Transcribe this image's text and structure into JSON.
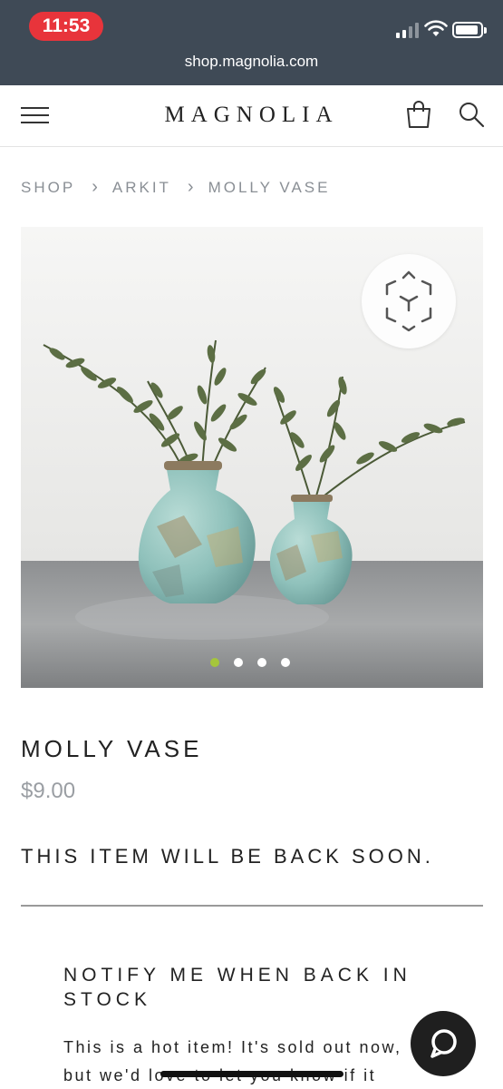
{
  "status_bar": {
    "time": "11:53",
    "time_pill_color": "#e8343b",
    "icons": [
      "cellular-signal-icon",
      "wifi-icon",
      "battery-icon"
    ]
  },
  "browser": {
    "url": "shop.magnolia.com"
  },
  "header": {
    "logo": "MAGNOLIA",
    "icons": [
      "hamburger-menu-icon",
      "shopping-bag-icon",
      "search-icon"
    ]
  },
  "breadcrumb": {
    "items": [
      "SHOP",
      "ARKIT",
      "MOLLY VASE"
    ],
    "separator_icon": "chevron-right-icon"
  },
  "gallery": {
    "ar_icon": "ar-cube-icon",
    "slide_count": 4,
    "active_slide": 1,
    "active_dot_color": "#a5c63b"
  },
  "product": {
    "title": "MOLLY VASE",
    "price": "$9.00",
    "availability": "THIS ITEM WILL BE BACK SOON."
  },
  "notify": {
    "heading": "NOTIFY ME WHEN BACK IN STOCK",
    "body": "This is a hot item! It's sold out now, but we'd love to let you know if it"
  },
  "chat": {
    "icon": "chat-bubble-icon"
  }
}
